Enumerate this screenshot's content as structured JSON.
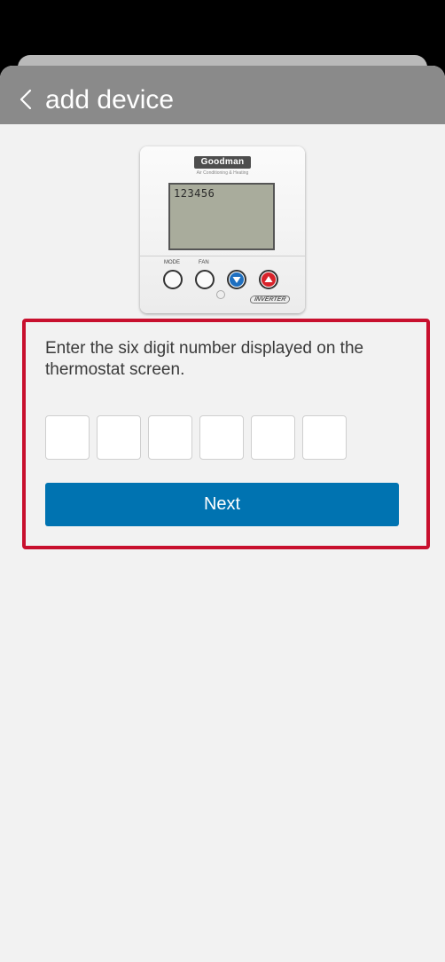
{
  "header": {
    "title": "add device",
    "back_icon": "chevron-left-icon"
  },
  "thermostat": {
    "brand": "Goodman",
    "brand_sub": "Air Conditioning & Heating",
    "screen_code": "123456",
    "mode_label": "MODE",
    "fan_label": "FAN",
    "badge": "INVERTER"
  },
  "form": {
    "instructions": "Enter the six digit number displayed on the thermostat screen.",
    "digits": [
      "",
      "",
      "",
      "",
      "",
      ""
    ],
    "next_label": "Next"
  },
  "colors": {
    "accent": "#0073b1",
    "highlight": "#c8102e",
    "header_bg": "#8a8a8a",
    "page_bg": "#f2f2f2"
  }
}
